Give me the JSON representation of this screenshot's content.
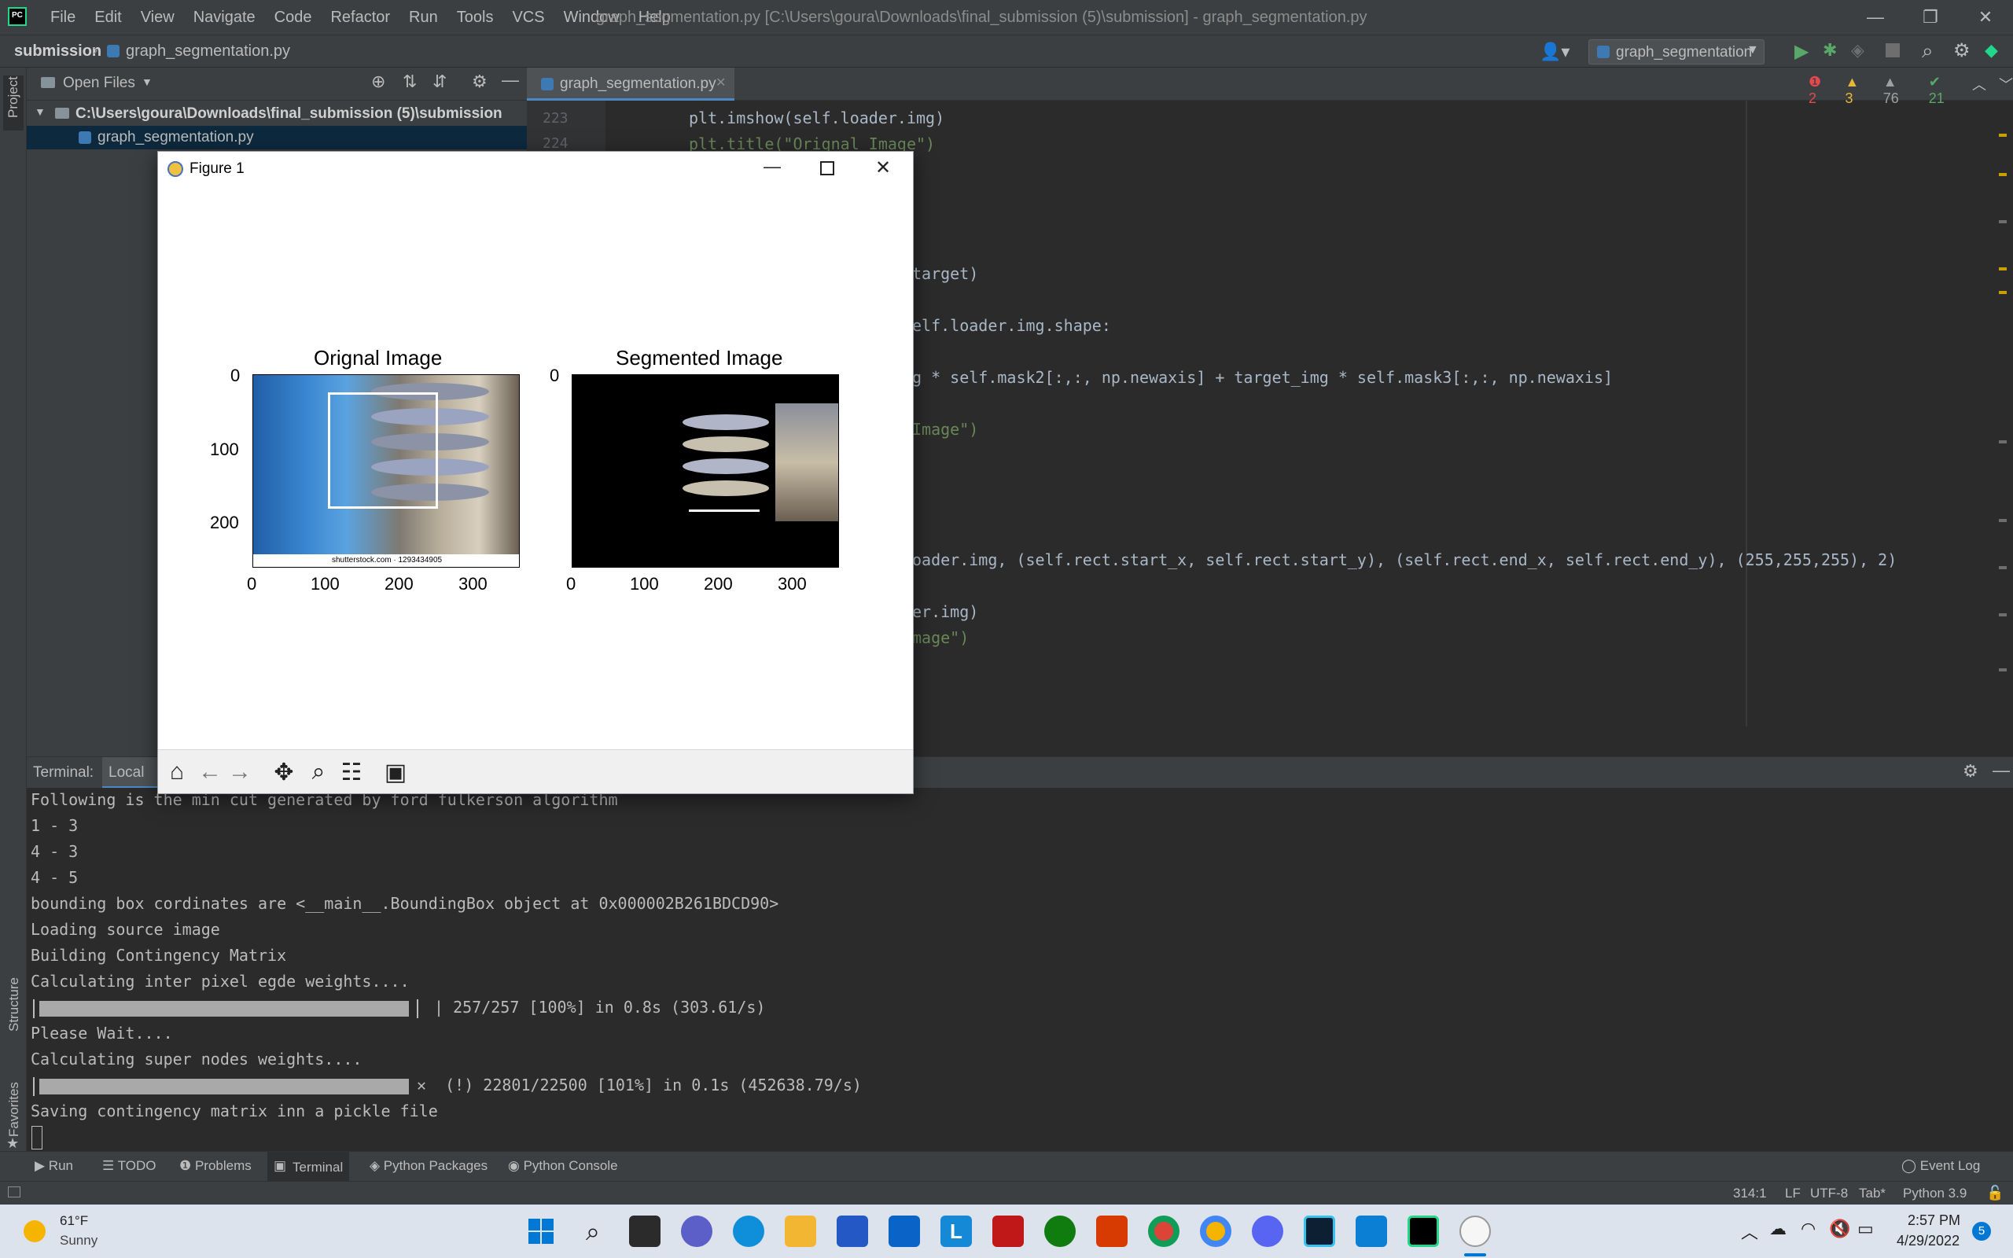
{
  "titlebar": {
    "menu": [
      "File",
      "Edit",
      "View",
      "Navigate",
      "Code",
      "Refactor",
      "Run",
      "Tools",
      "VCS",
      "Window",
      "Help"
    ],
    "window_title": "graph_segmentation.py [C:\\Users\\goura\\Downloads\\final_submission (5)\\submission] - graph_segmentation.py"
  },
  "navbar": {
    "crumb_project": "submission",
    "crumb_file": "graph_segmentation.py",
    "run_config": "graph_segmentation"
  },
  "project": {
    "header": "Open Files",
    "root": "C:\\Users\\goura\\Downloads\\final_submission (5)\\submission",
    "file": "graph_segmentation.py",
    "side_label": "Project"
  },
  "editor": {
    "tab": "graph_segmentation.py",
    "inspections": {
      "errors": "2",
      "warnings": "3",
      "weak": "76",
      "ok": "21"
    },
    "line_numbers": [
      "223",
      "224"
    ],
    "lines": [
      {
        "text": "plt.imshow(self.loader.img)"
      },
      {
        "text": "plt.title(\"Orignal Image\")"
      },
      {
        "text": "target)"
      },
      {
        "text": "elf.loader.img.shape:"
      },
      {
        "text": "g * self.mask2[:,:, np.newaxis] + target_img * self.mask3[:,:, np.newaxis]"
      },
      {
        "text": "Image\")"
      },
      {
        "text": "oader.img, (self.rect.start_x, self.rect.start_y), (self.rect.end_x, self.rect.end_y), (255,255,255), 2)"
      },
      {
        "text": "er.img)"
      },
      {
        "text": "mage\")"
      }
    ]
  },
  "figure": {
    "title": "Figure 1",
    "left_title": "Orignal Image",
    "right_title": "Segmented Image",
    "watermark": "shutterstock.com · 1293434905",
    "x_ticks": [
      "0",
      "100",
      "200",
      "300"
    ],
    "y_ticks": [
      "0",
      "100",
      "200"
    ]
  },
  "terminal": {
    "label": "Terminal:",
    "tab": "Local",
    "lines": [
      "Following is the min cut generated by ford fulkerson algorithm",
      "1 - 3",
      "4 - 3",
      "4 - 5",
      "bounding box cordinates are <__main__.BoundingBox object at 0x000002B261BDCD90>",
      "Loading source image",
      "Building Contingency Matrix",
      "Calculating inter pixel egde weights....",
      "| 257/257 [100%] in 0.8s (303.61/s)",
      "Please Wait....",
      "Calculating super nodes weights....",
      "✕  (!) 22801/22500 [101%] in 0.1s (452638.79/s)",
      "Saving contingency matrix inn a pickle file"
    ],
    "progress1": 1.0,
    "progress2": 1.0
  },
  "toolwindows": [
    "Run",
    "TODO",
    "Problems",
    "Terminal",
    "Python Packages",
    "Python Console"
  ],
  "event_log": "Event Log",
  "side_labels": {
    "structure": "Structure",
    "favorites": "Favorites"
  },
  "status": {
    "position": "314:1",
    "line_sep": "LF",
    "encoding": "UTF-8",
    "indent": "Tab*",
    "interpreter": "Python 3.9"
  },
  "taskbar": {
    "temp": "61°F",
    "weather": "Sunny",
    "time": "2:57 PM",
    "date": "4/29/2022",
    "notif": "5",
    "colors": {
      "accent": "#0078d4"
    }
  }
}
